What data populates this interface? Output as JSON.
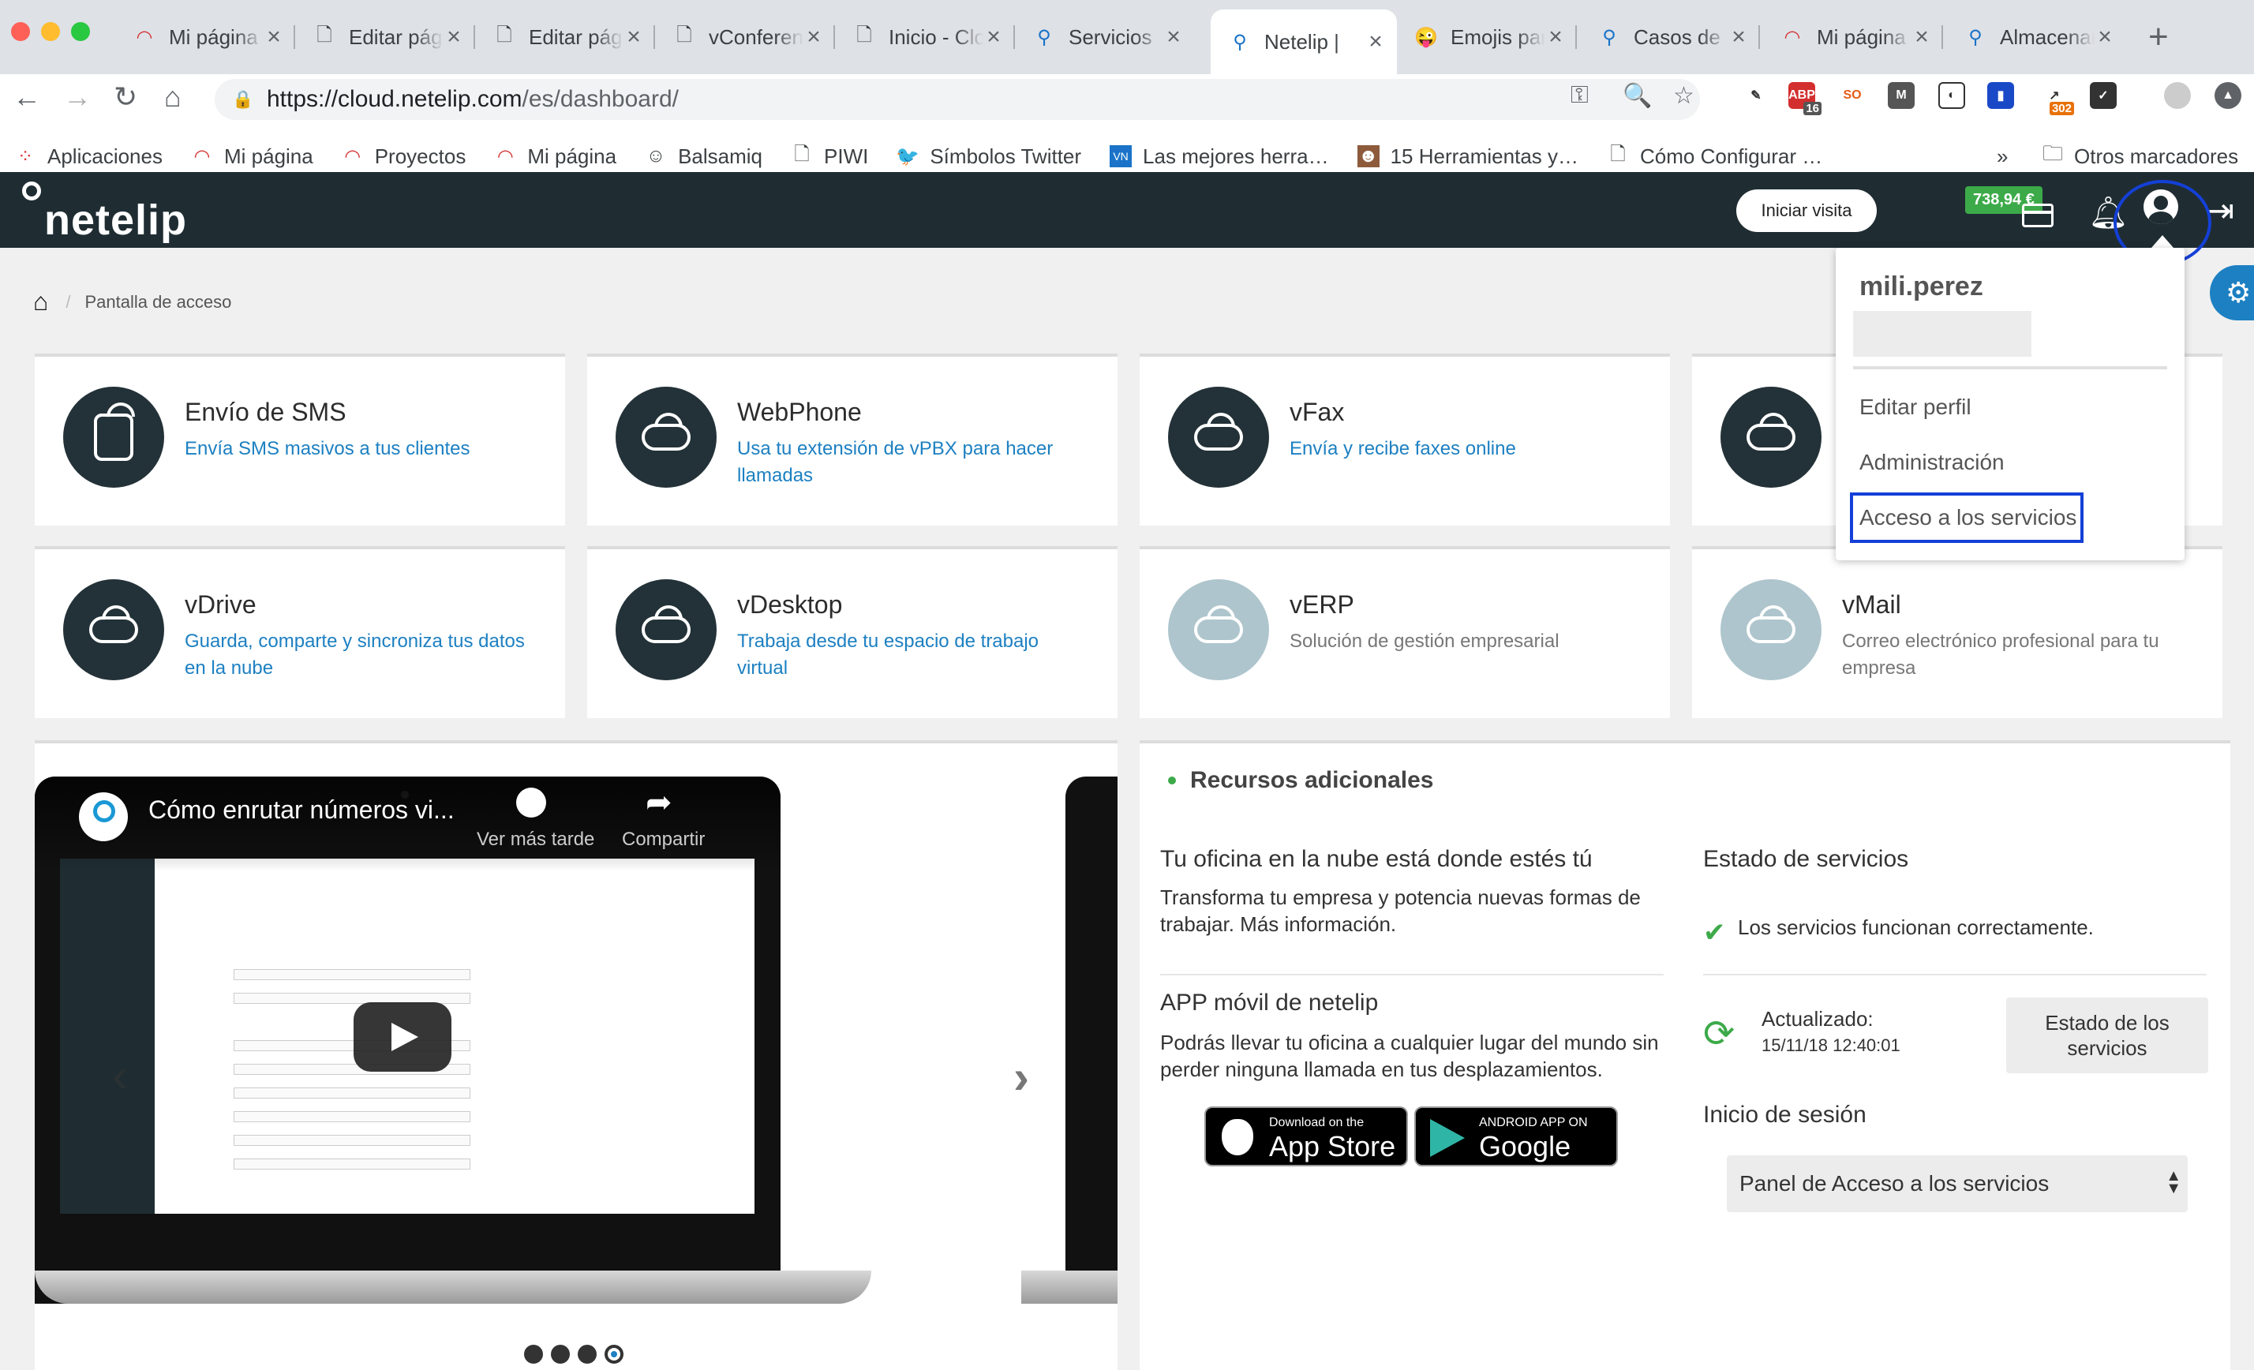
{
  "browser": {
    "tabs": [
      {
        "title": "Mi página",
        "icon": "netelip-red-icon"
      },
      {
        "title": "Editar página",
        "icon": "doc-icon"
      },
      {
        "title": "Editar página",
        "icon": "doc-icon"
      },
      {
        "title": "vConferencia",
        "icon": "doc-icon"
      },
      {
        "title": "Inicio - Cloud",
        "icon": "doc-icon"
      },
      {
        "title": "Servicios",
        "icon": "netelip-pin-icon"
      },
      {
        "title": "Netelip |",
        "icon": "netelip-pin-icon",
        "active": true
      },
      {
        "title": "Emojis para",
        "icon": "emoji-icon"
      },
      {
        "title": "Casos de",
        "icon": "netelip-pin-icon"
      },
      {
        "title": "Mi página",
        "icon": "netelip-red-icon"
      },
      {
        "title": "Almacenamiento",
        "icon": "netelip-pin-icon"
      }
    ],
    "url_host": "https://cloud.netelip.com",
    "url_path": "/es/dashboard/",
    "bookmarks": [
      {
        "label": "Aplicaciones",
        "icon": "apps-grid-icon"
      },
      {
        "label": "Mi página",
        "icon": "netelip-red-icon"
      },
      {
        "label": "Proyectos",
        "icon": "netelip-red-icon"
      },
      {
        "label": "Mi página",
        "icon": "netelip-red-icon"
      },
      {
        "label": "Balsamiq",
        "icon": "balsamiq-icon"
      },
      {
        "label": "PIWI",
        "icon": "doc-icon"
      },
      {
        "label": "Símbolos Twitter",
        "icon": "twitter-icon"
      },
      {
        "label": "Las mejores herra…",
        "icon": "vn-icon"
      },
      {
        "label": "15 Herramientas y…",
        "icon": "person-icon"
      },
      {
        "label": "Cómo Configurar …",
        "icon": "doc-icon"
      }
    ],
    "bookmarks_more": "»",
    "other_bookmarks": "Otros marcadores",
    "extensions": [
      {
        "name": "pen-extension-icon",
        "badge": ""
      },
      {
        "name": "adblock-extension-icon",
        "badge": "16"
      },
      {
        "name": "so-extension-icon",
        "badge": ""
      },
      {
        "name": "m-extension-icon",
        "badge": ""
      },
      {
        "name": "keeper-extension-icon",
        "badge": ""
      },
      {
        "name": "flag-extension-icon",
        "badge": ""
      },
      {
        "name": "redirect-extension-icon",
        "badge": "302"
      },
      {
        "name": "check-extension-icon",
        "badge": ""
      }
    ]
  },
  "app": {
    "logo": "netelip",
    "visit_button": "Iniciar visita",
    "balance": "738,94 €",
    "breadcrumb_current": "Pantalla de acceso",
    "services": [
      {
        "title": "Envío de SMS",
        "desc": "Envía SMS masivos a tus clientes",
        "enabled": true,
        "icon": "sms-icon"
      },
      {
        "title": "WebPhone",
        "desc": "Usa tu extensión de vPBX para hacer llamadas",
        "enabled": true,
        "icon": "webphone-cloud-icon"
      },
      {
        "title": "vFax",
        "desc": "Envía y recibe faxes online",
        "enabled": true,
        "icon": "fax-cloud-icon"
      },
      {
        "title": "",
        "desc": "",
        "enabled": true,
        "icon": "bulb-cloud-icon"
      },
      {
        "title": "vDrive",
        "desc": "Guarda, comparte y sincroniza tus datos en la nube",
        "enabled": true,
        "icon": "drive-cloud-icon"
      },
      {
        "title": "vDesktop",
        "desc": "Trabaja desde tu espacio de trabajo virtual",
        "enabled": true,
        "icon": "desktop-cloud-icon"
      },
      {
        "title": "vERP",
        "desc": "Solución de gestión empresarial",
        "enabled": false,
        "icon": "erp-cloud-icon"
      },
      {
        "title": "vMail",
        "desc": "Correo electrónico profesional para tu empresa",
        "enabled": false,
        "icon": "mail-cloud-icon"
      }
    ],
    "user_menu": {
      "username": "mili.perez",
      "items": [
        "Editar perfil",
        "Administración",
        "Acceso a los servicios"
      ]
    },
    "video": {
      "title": "Cómo enrutar números vi...",
      "watch_later": "Ver más tarde",
      "share": "Compartir",
      "slides_total": 4,
      "slide_active": 4
    },
    "resources": {
      "heading": "Recursos adicionales",
      "office_title": "Tu oficina en la nube está donde estés tú",
      "office_text": "Transforma tu empresa y potencia nuevas formas de trabajar. Más información.",
      "app_title": "APP móvil de netelip",
      "app_text": "Podrás llevar tu oficina a cualquier lugar del mundo sin perder ninguna llamada en tus desplazamientos.",
      "appstore_small": "Download on the",
      "appstore_big": "App Store",
      "gplay_small": "ANDROID APP ON",
      "gplay_big": "Google play",
      "status_title": "Estado de servicios",
      "status_text": "Los servicios funcionan correctamente.",
      "updated_label": "Actualizado:",
      "updated_date": "15/11/18 12:40:01",
      "status_button": "Estado de los servicios",
      "login_title": "Inicio de sesión",
      "login_select": "Panel de Acceso a los servicios"
    }
  }
}
